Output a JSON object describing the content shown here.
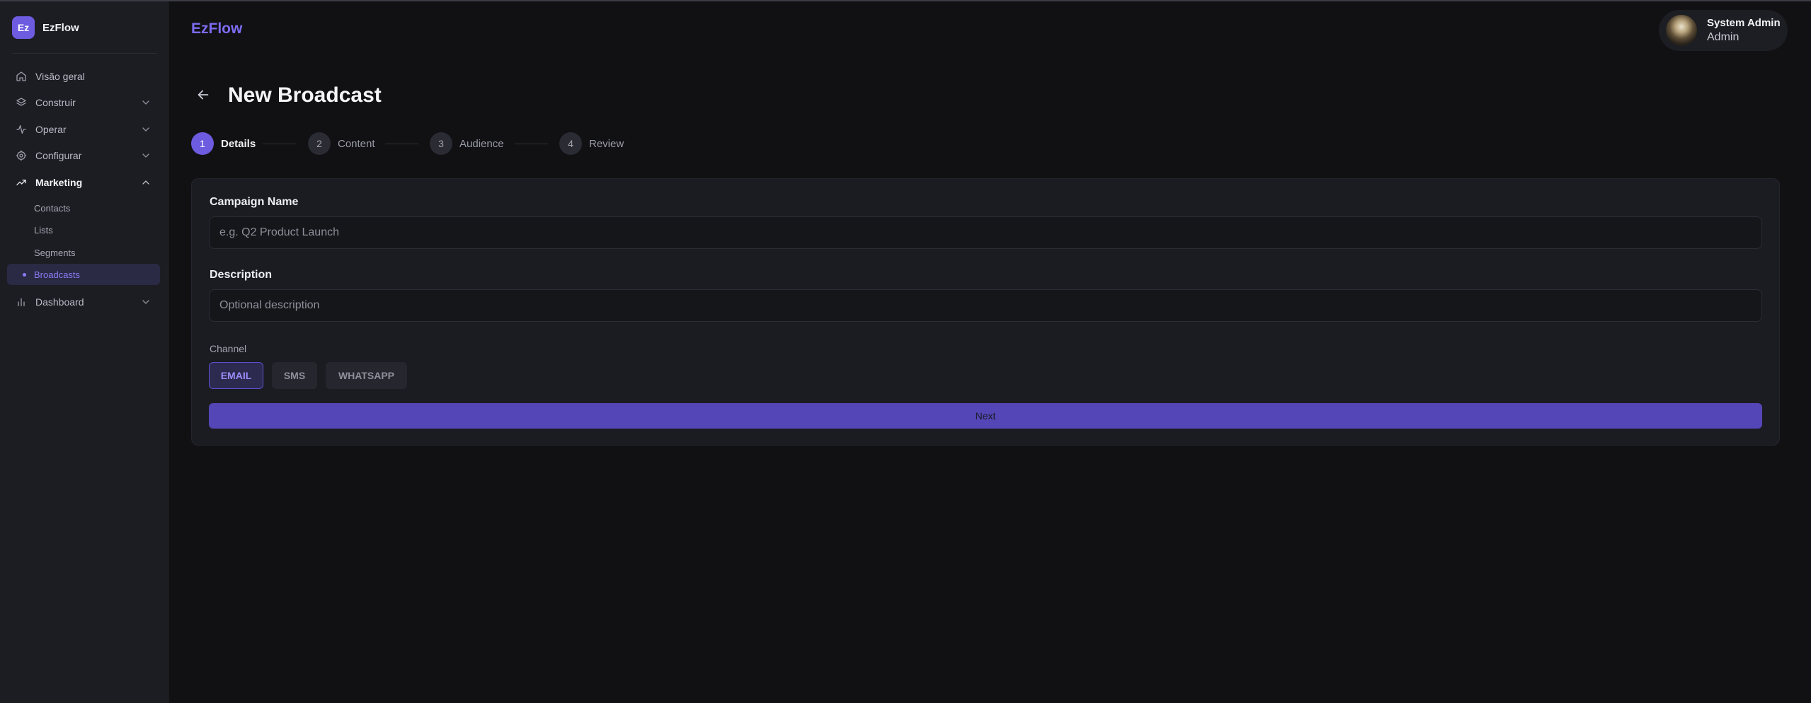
{
  "brand": {
    "logo": "Ez",
    "name": "EzFlow"
  },
  "sidebar": {
    "items": [
      {
        "label": "Visão geral",
        "icon": "home-icon"
      },
      {
        "label": "Construir",
        "icon": "layers-icon"
      },
      {
        "label": "Operar",
        "icon": "activity-icon"
      },
      {
        "label": "Configurar",
        "icon": "gear-icon"
      },
      {
        "label": "Marketing",
        "icon": "trending-up-icon"
      },
      {
        "label": "Dashboard",
        "icon": "bar-chart-icon"
      }
    ],
    "marketing_sub": [
      "Contacts",
      "Lists",
      "Segments",
      "Broadcasts"
    ],
    "active_sub": "Broadcasts"
  },
  "header": {
    "app_title": "EzFlow",
    "user": {
      "name": "System Admin",
      "role": "Admin"
    }
  },
  "page": {
    "title": "New Broadcast"
  },
  "stepper": {
    "current": 1,
    "steps": [
      {
        "num": "1",
        "label": "Details"
      },
      {
        "num": "2",
        "label": "Content"
      },
      {
        "num": "3",
        "label": "Audience"
      },
      {
        "num": "4",
        "label": "Review"
      }
    ]
  },
  "form": {
    "campaign_name": {
      "label": "Campaign Name",
      "placeholder": "e.g. Q2 Product Launch",
      "value": ""
    },
    "description": {
      "label": "Description",
      "placeholder": "Optional description",
      "value": ""
    },
    "channel": {
      "label": "Channel",
      "options": [
        "EMAIL",
        "SMS",
        "WHATSAPP"
      ],
      "selected": "EMAIL"
    },
    "next_label": "Next"
  },
  "colors": {
    "accent": "#6d5ce0",
    "background": "#111114",
    "sidebar": "#1c1d23",
    "card": "#1b1c22"
  }
}
